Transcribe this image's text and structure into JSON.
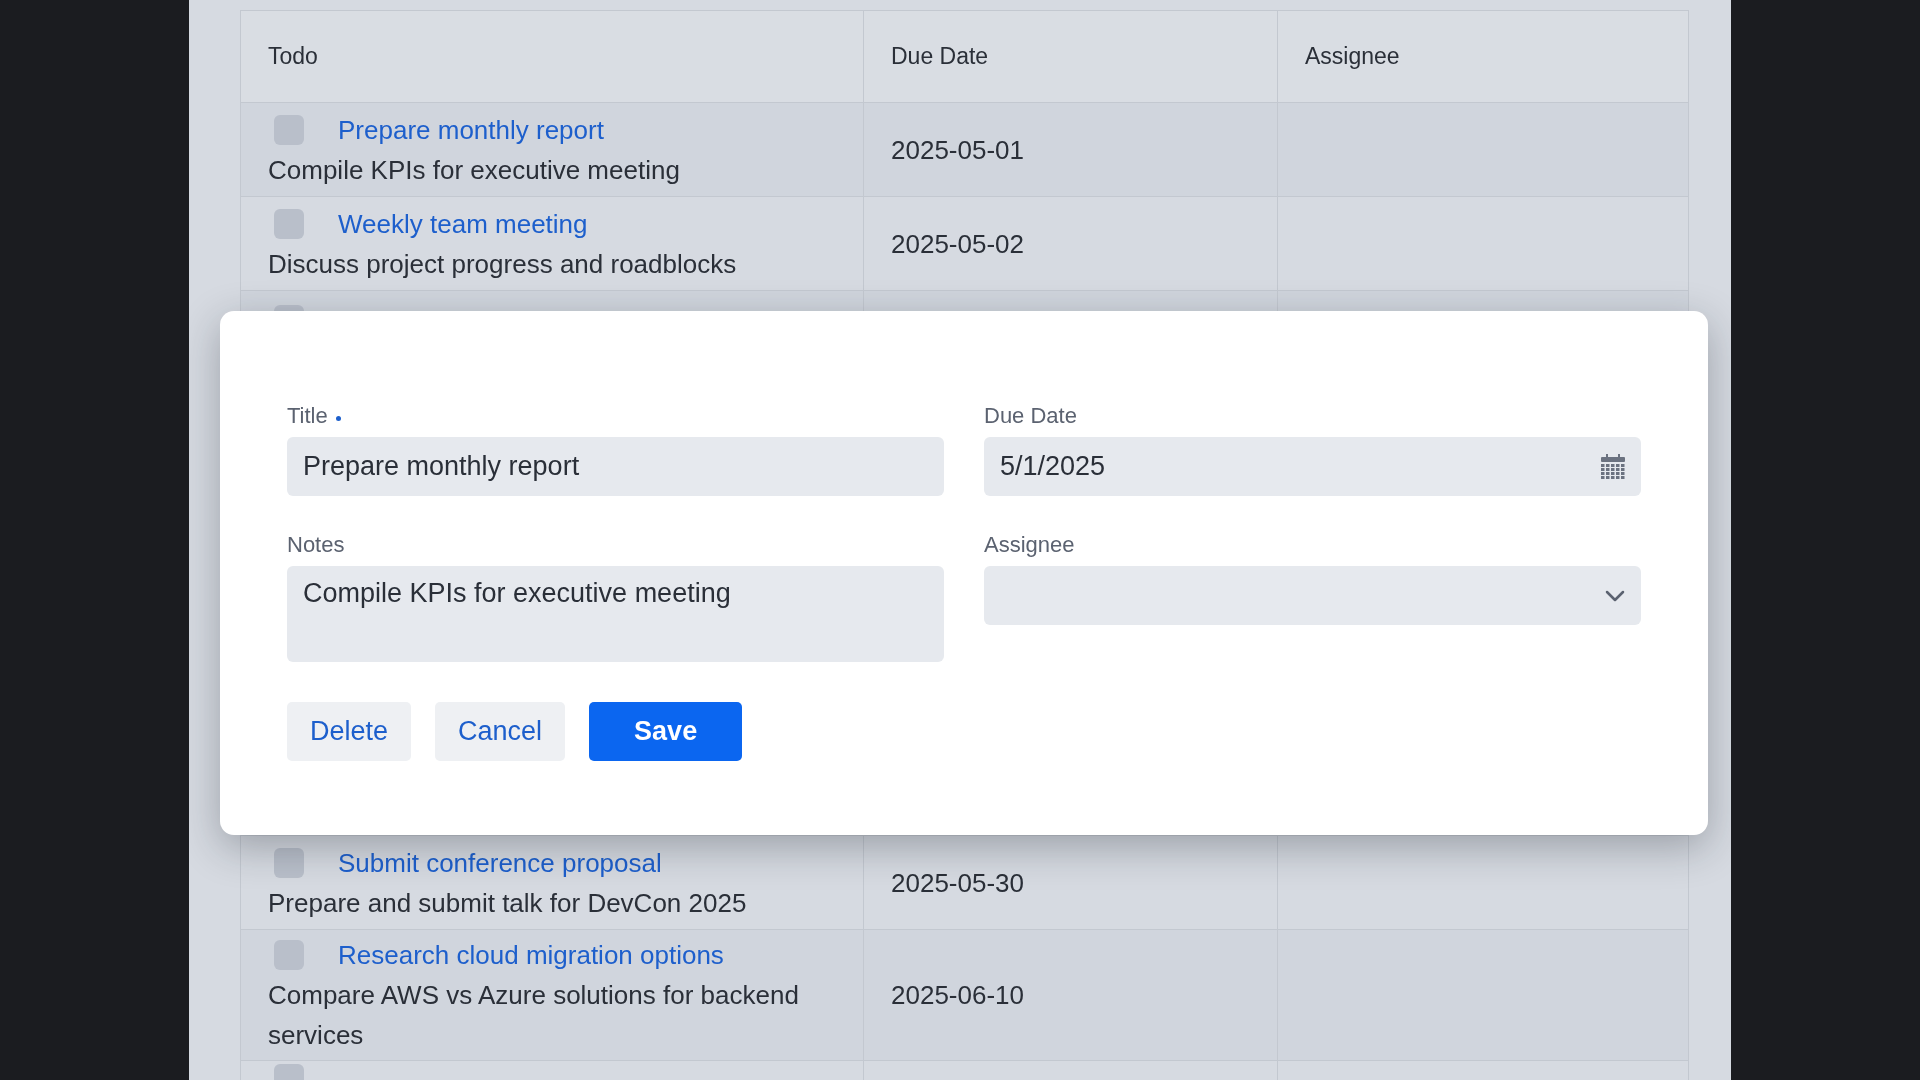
{
  "table": {
    "columns": [
      "Todo",
      "Due Date",
      "Assignee"
    ],
    "rows": [
      {
        "title": "Prepare monthly report",
        "notes": "Compile KPIs for executive meeting",
        "due_date": "2025-05-01",
        "done": false
      },
      {
        "title": "Weekly team meeting",
        "notes": "Discuss project progress and roadblocks",
        "due_date": "2025-05-02",
        "done": false
      },
      {
        "kind": "hidden",
        "done": false
      },
      {
        "title": "Submit conference proposal",
        "notes": "Prepare and submit talk for DevCon 2025",
        "due_date": "2025-05-30",
        "done": false
      },
      {
        "title": "Research cloud migration options",
        "notes": "Compare AWS vs Azure solutions for backend services",
        "due_date": "2025-06-10",
        "done": false
      },
      {
        "kind": "cut",
        "done": false
      }
    ]
  },
  "dialog": {
    "fields": [
      {
        "kind": "text",
        "label": "Title",
        "required": true,
        "value": "Prepare monthly report"
      },
      {
        "kind": "date",
        "label": "Due Date",
        "required": false,
        "value": "5/1/2025"
      },
      {
        "kind": "textarea",
        "label": "Notes",
        "required": false,
        "value": "Compile KPIs for executive meeting"
      },
      {
        "kind": "select",
        "label": "Assignee",
        "required": false
      }
    ],
    "buttons": [
      {
        "label": "Delete",
        "kind": "secondary"
      },
      {
        "label": "Cancel",
        "kind": "secondary"
      },
      {
        "label": "Save",
        "kind": "primary"
      }
    ]
  }
}
